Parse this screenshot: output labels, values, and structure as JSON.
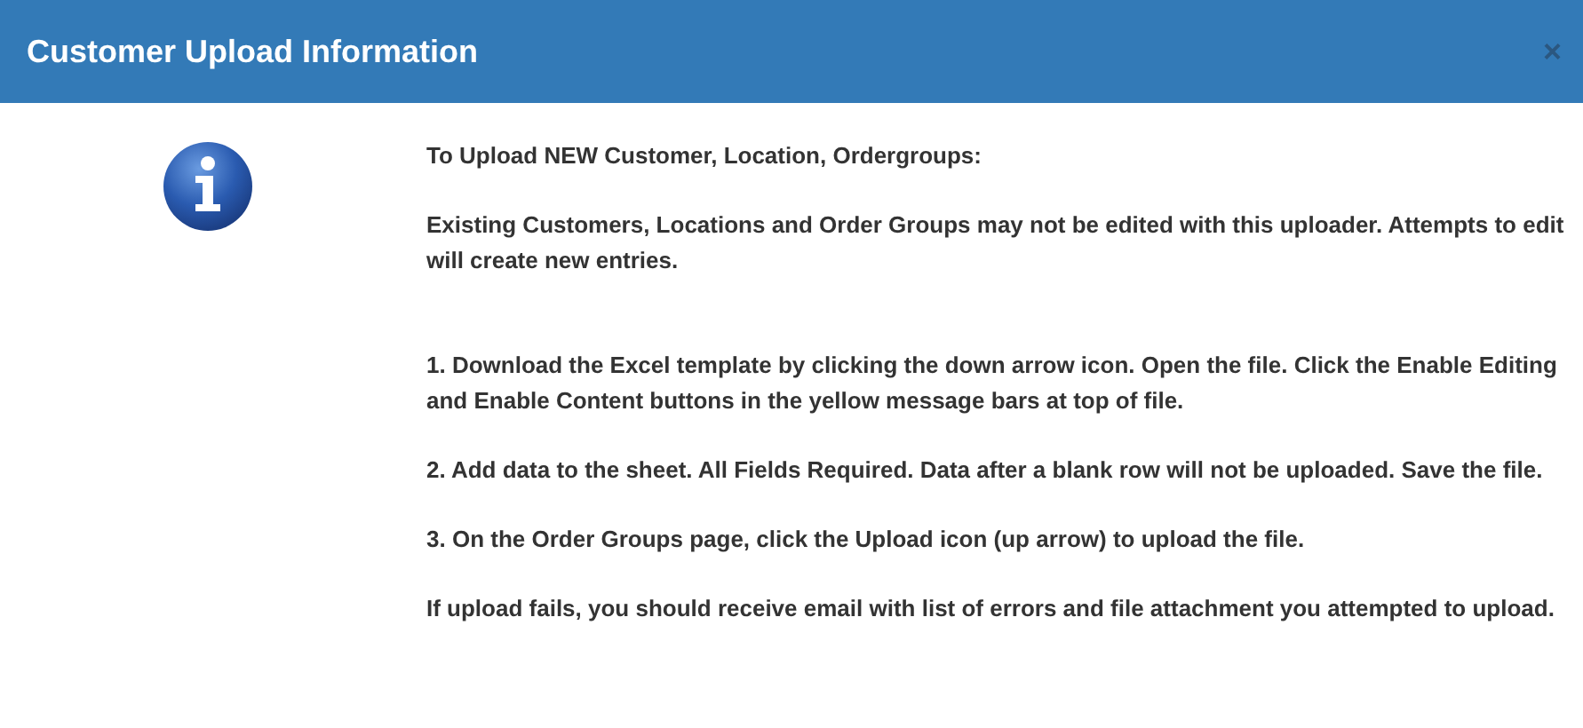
{
  "dialog": {
    "title": "Customer Upload Information",
    "close": "×"
  },
  "paragraphs": [
    "To Upload NEW Customer, Location, Ordergroups:",
    "Existing Customers, Locations and Order Groups may not be edited with this uploader. Attempts to edit will create new entries.",
    "1. Download the Excel template by clicking the down arrow icon. Open the file. Click the Enable Editing and Enable Content buttons in the yellow message bars at top of file.",
    "2. Add data to the sheet. All Fields Required. Data after a blank row will not be uploaded. Save the file.",
    "3. On the Order Groups page, click the Upload icon (up arrow) to upload the file.",
    "If upload fails, you should receive email with list of errors and file attachment you attempted to upload."
  ]
}
